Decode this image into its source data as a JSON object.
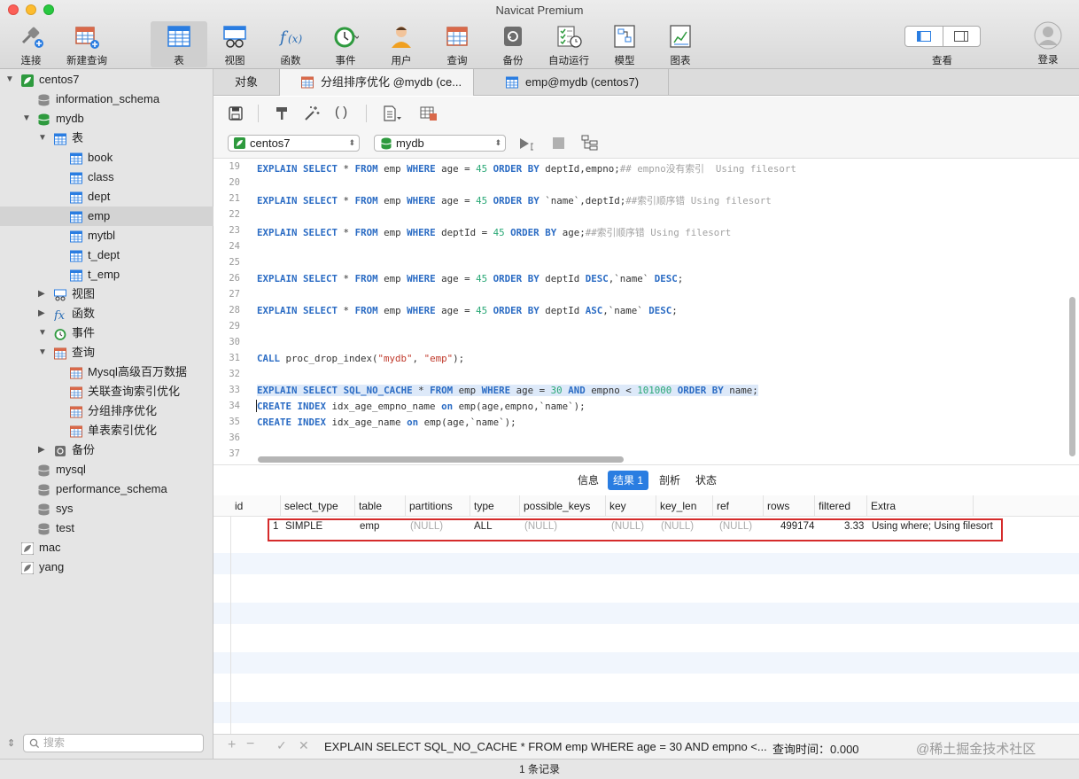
{
  "window": {
    "title": "Navicat Premium"
  },
  "toolbar": {
    "items": [
      {
        "label": "连接"
      },
      {
        "label": "新建查询"
      },
      {
        "label": "表"
      },
      {
        "label": "视图"
      },
      {
        "label": "函数"
      },
      {
        "label": "事件"
      },
      {
        "label": "用户"
      },
      {
        "label": "查询"
      },
      {
        "label": "备份"
      },
      {
        "label": "自动运行"
      },
      {
        "label": "模型"
      },
      {
        "label": "图表"
      }
    ],
    "view_label": "查看",
    "login_label": "登录"
  },
  "sidebar": {
    "connection": "centos7",
    "schemas_top": [
      "information_schema",
      "mydb"
    ],
    "tables_label": "表",
    "tables": [
      "book",
      "class",
      "dept",
      "emp",
      "mytbl",
      "t_dept",
      "t_emp"
    ],
    "views_label": "视图",
    "functions_label": "函数",
    "events_label": "事件",
    "queries_label": "查询",
    "queries": [
      "Mysql高级百万数据",
      "关联查询索引优化",
      "分组排序优化",
      "单表索引优化"
    ],
    "backup_label": "备份",
    "schemas_bottom": [
      "mysql",
      "performance_schema",
      "sys",
      "test"
    ],
    "other_connections": [
      "mac",
      "yang"
    ],
    "search_placeholder": "搜索"
  },
  "tabs": {
    "objects": "对象",
    "query_tab": "分组排序优化 @mydb (ce...",
    "table_tab": "emp@mydb (centos7)"
  },
  "dbbar": {
    "connection": "centos7",
    "database": "mydb"
  },
  "editor": {
    "lines": [
      {
        "n": "19",
        "code": "EXPLAIN SELECT * FROM emp WHERE age = 45 ORDER BY deptId,empno;## empno没有索引  Using filesort"
      },
      {
        "n": "20",
        "code": ""
      },
      {
        "n": "21",
        "code": "EXPLAIN SELECT * FROM emp WHERE age = 45 ORDER BY `name`,deptId;##索引顺序错 Using filesort"
      },
      {
        "n": "22",
        "code": ""
      },
      {
        "n": "23",
        "code": "EXPLAIN SELECT * FROM emp WHERE deptId = 45 ORDER BY age;##索引顺序错 Using filesort"
      },
      {
        "n": "24",
        "code": ""
      },
      {
        "n": "25",
        "code": ""
      },
      {
        "n": "26",
        "code": "EXPLAIN SELECT * FROM emp WHERE age = 45 ORDER BY deptId DESC,`name` DESC;"
      },
      {
        "n": "27",
        "code": ""
      },
      {
        "n": "28",
        "code": "EXPLAIN SELECT * FROM emp WHERE age = 45 ORDER BY deptId ASC,`name` DESC;"
      },
      {
        "n": "29",
        "code": ""
      },
      {
        "n": "30",
        "code": ""
      },
      {
        "n": "31",
        "code": "CALL proc_drop_index(\"mydb\", \"emp\");"
      },
      {
        "n": "32",
        "code": ""
      },
      {
        "n": "33",
        "code": "EXPLAIN SELECT SQL_NO_CACHE * FROM emp WHERE age = 30 AND empno < 101000 ORDER BY name;"
      },
      {
        "n": "34",
        "code": "CREATE INDEX idx_age_empno_name on emp(age,empno,`name`);"
      },
      {
        "n": "35",
        "code": "CREATE INDEX idx_age_name on emp(age,`name`);"
      },
      {
        "n": "36",
        "code": ""
      },
      {
        "n": "37",
        "code": ""
      }
    ]
  },
  "result_tabs": [
    "信息",
    "结果 1",
    "剖析",
    "状态"
  ],
  "result": {
    "columns": [
      "id",
      "select_type",
      "table",
      "partitions",
      "type",
      "possible_keys",
      "key",
      "key_len",
      "ref",
      "rows",
      "filtered",
      "Extra"
    ],
    "row": [
      "1",
      "SIMPLE",
      "emp",
      "(NULL)",
      "ALL",
      "(NULL)",
      "(NULL)",
      "(NULL)",
      "(NULL)",
      "499174",
      "3.33",
      "Using where; Using filesort"
    ]
  },
  "bottombar": {
    "sql": "EXPLAIN SELECT SQL_NO_CACHE * FROM emp WHERE age = 30 AND empno <...",
    "query_time": "查询时间：0.000",
    "watermark": "@稀土掘金技术社区"
  },
  "statusbar": {
    "records": "1 条记录"
  },
  "colors": {
    "accent": "#2a7de1",
    "highlight_box": "#d52b2b",
    "keyword": "#2b6cc4"
  }
}
